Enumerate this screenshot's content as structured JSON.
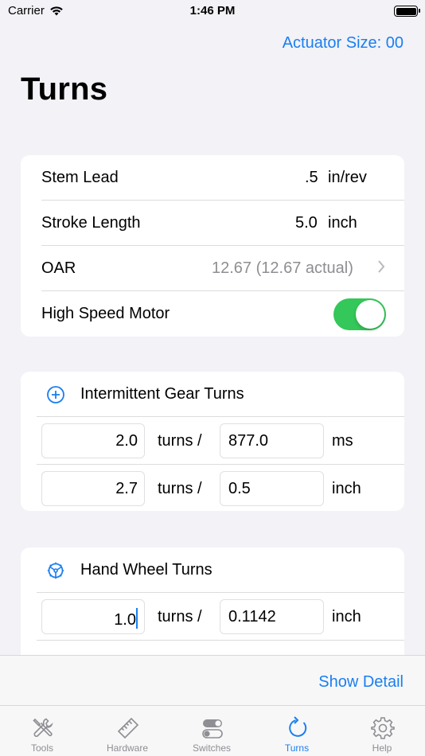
{
  "status": {
    "carrier": "Carrier",
    "time": "1:46 PM"
  },
  "nav": {
    "action": "Actuator Size: 00"
  },
  "title": "Turns",
  "settings": {
    "stem_lead": {
      "label": "Stem Lead",
      "value": ".5",
      "unit": "in/rev"
    },
    "stroke_length": {
      "label": "Stroke Length",
      "value": "5.0",
      "unit": "inch"
    },
    "oar": {
      "label": "OAR",
      "value": "12.67 (12.67 actual)"
    },
    "high_speed_motor": {
      "label": "High Speed Motor",
      "on": true
    }
  },
  "intermittent": {
    "title": "Intermittent Gear Turns",
    "icon": "plus-circle-icon",
    "rows": [
      {
        "turns_value": "2.0",
        "turns_label": "turns /",
        "rate_value": "877.0",
        "unit": "ms"
      },
      {
        "turns_value": "2.7",
        "turns_label": "turns /",
        "rate_value": "0.5",
        "unit": "inch"
      }
    ]
  },
  "handwheel": {
    "title": "Hand Wheel Turns",
    "icon": "steering-wheel-icon",
    "rows": [
      {
        "turns_value": "1.0",
        "turns_label": "turns /",
        "rate_value": "0.1142",
        "unit": "inch"
      }
    ]
  },
  "footer": {
    "show_detail": "Show Detail"
  },
  "tabs": [
    {
      "label": "Tools",
      "icon": "tools-icon"
    },
    {
      "label": "Hardware",
      "icon": "ruler-icon"
    },
    {
      "label": "Switches",
      "icon": "switches-icon"
    },
    {
      "label": "Turns",
      "icon": "rotate-arrow-icon",
      "active": true
    },
    {
      "label": "Help",
      "icon": "gear-icon"
    }
  ],
  "colors": {
    "accent": "#1a7ff0",
    "toggle_on": "#34c759",
    "background": "#f2f2f7"
  }
}
